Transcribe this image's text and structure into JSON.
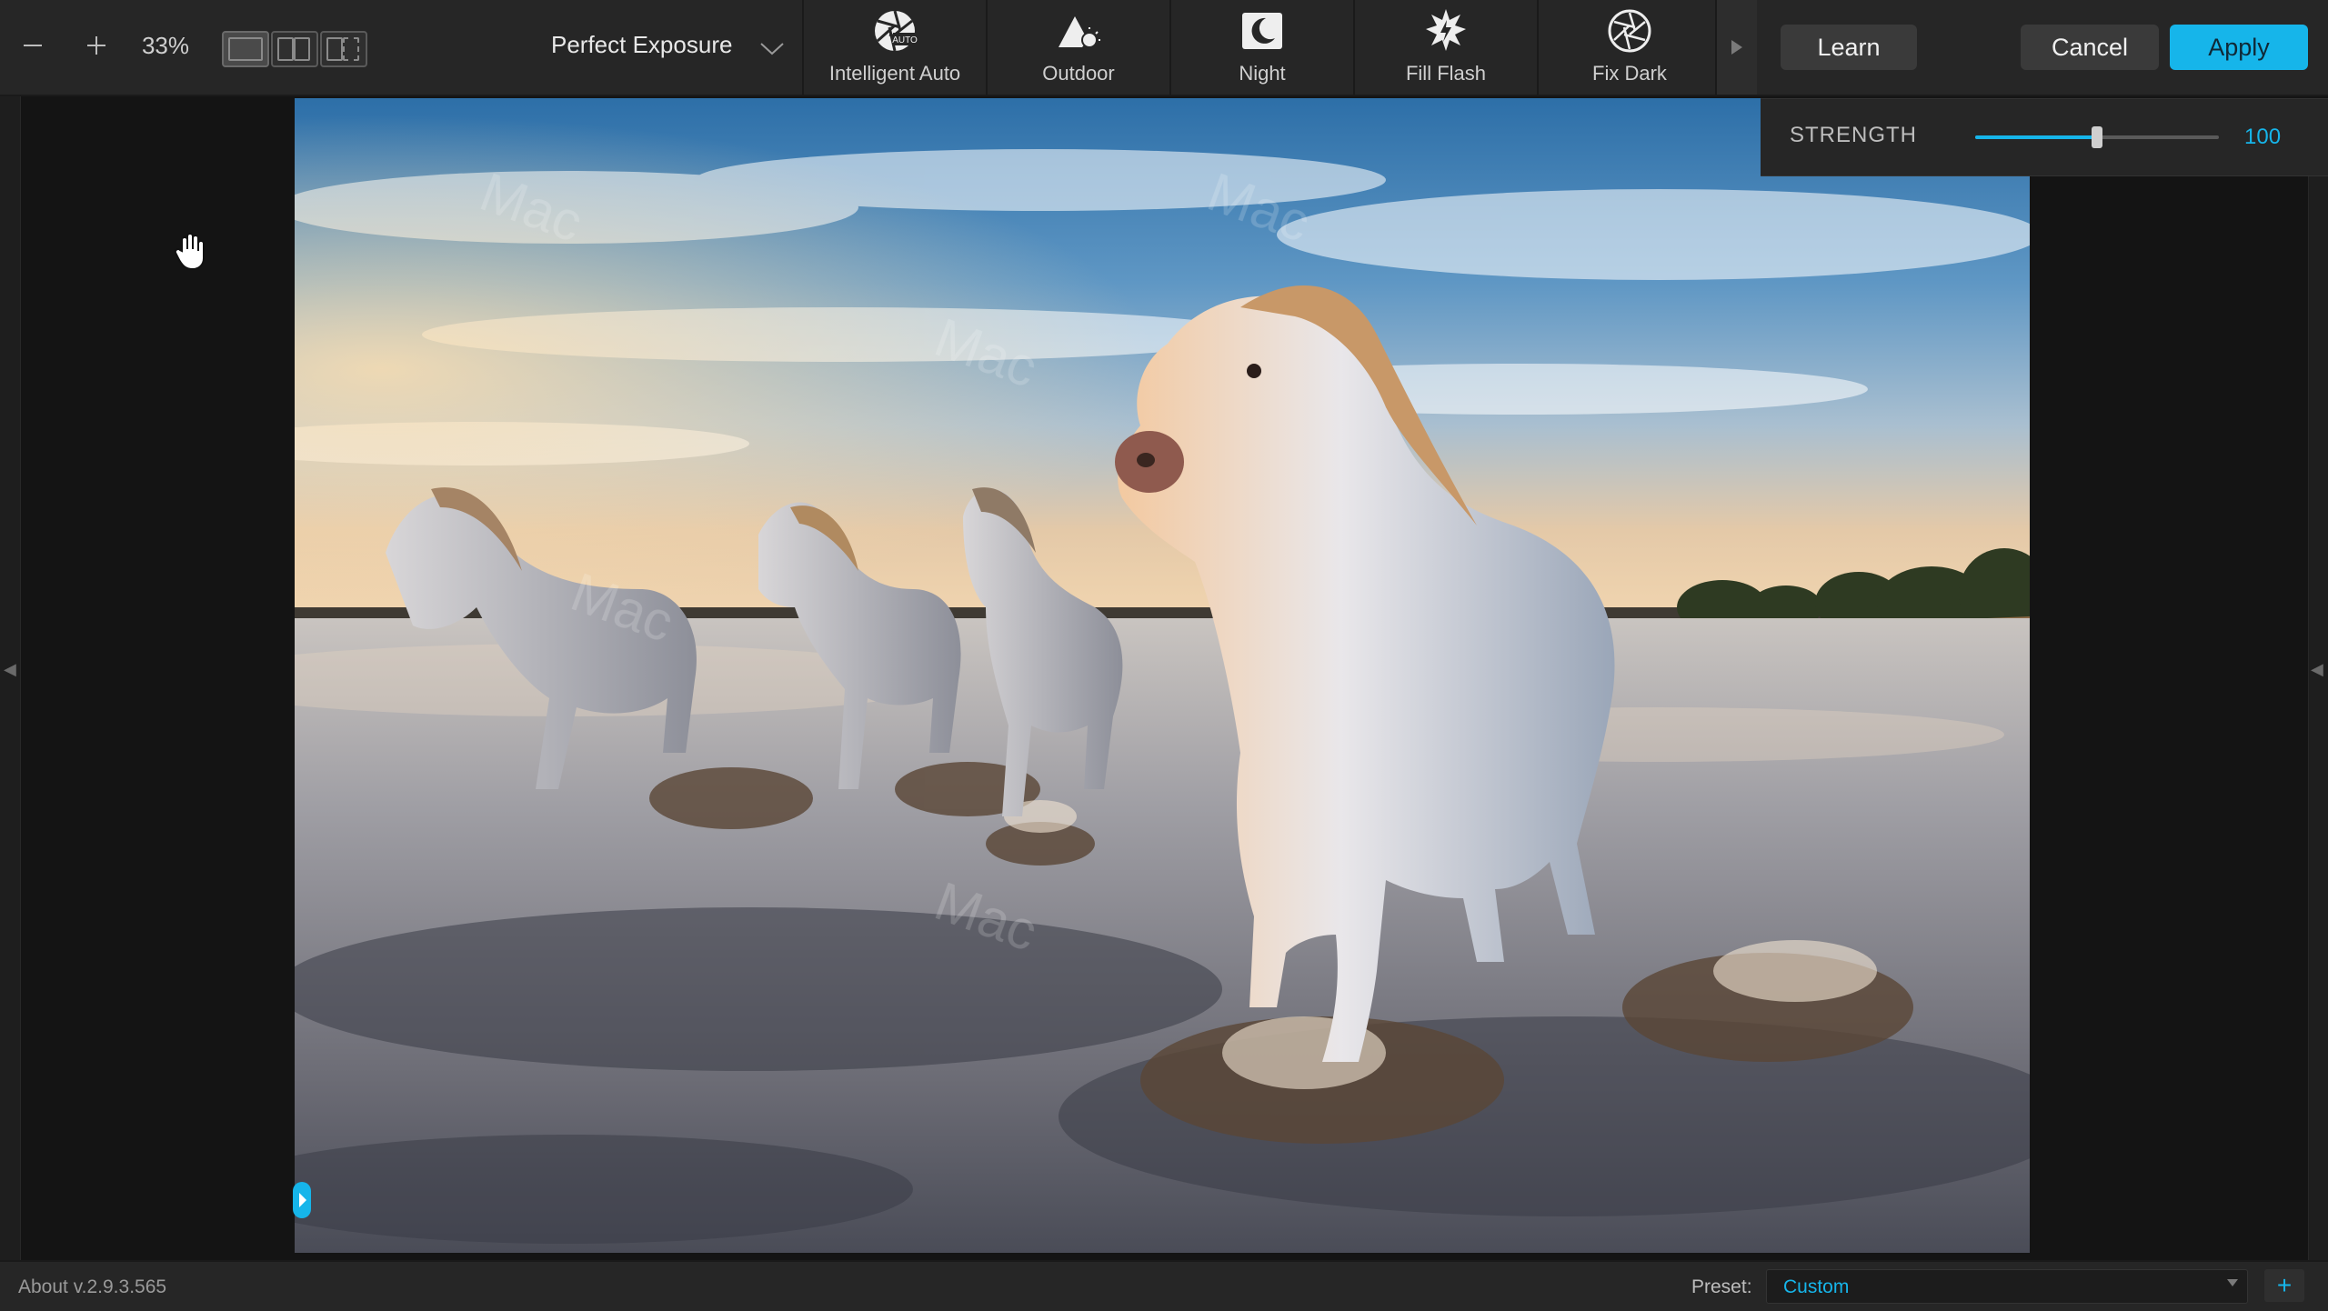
{
  "toolbar": {
    "zoom_level": "33%",
    "preset_group": "Perfect Exposure",
    "presets": [
      {
        "label": "Intelligent Auto",
        "icon": "aperture-auto-icon"
      },
      {
        "label": "Outdoor",
        "icon": "mountain-sun-icon"
      },
      {
        "label": "Night",
        "icon": "moon-icon"
      },
      {
        "label": "Fill Flash",
        "icon": "flash-burst-icon"
      },
      {
        "label": "Fix Dark",
        "icon": "aperture-icon"
      }
    ],
    "learn_label": "Learn",
    "cancel_label": "Cancel",
    "apply_label": "Apply"
  },
  "adjustments": {
    "strength_label": "STRENGTH",
    "strength_value": "100",
    "strength_level": 0.5
  },
  "status": {
    "version": "About v.2.9.3.565",
    "preset_label": "Preset:",
    "preset_value": "Custom"
  },
  "colors": {
    "accent": "#16b5ea",
    "background": "#141414",
    "panel": "#262626"
  }
}
